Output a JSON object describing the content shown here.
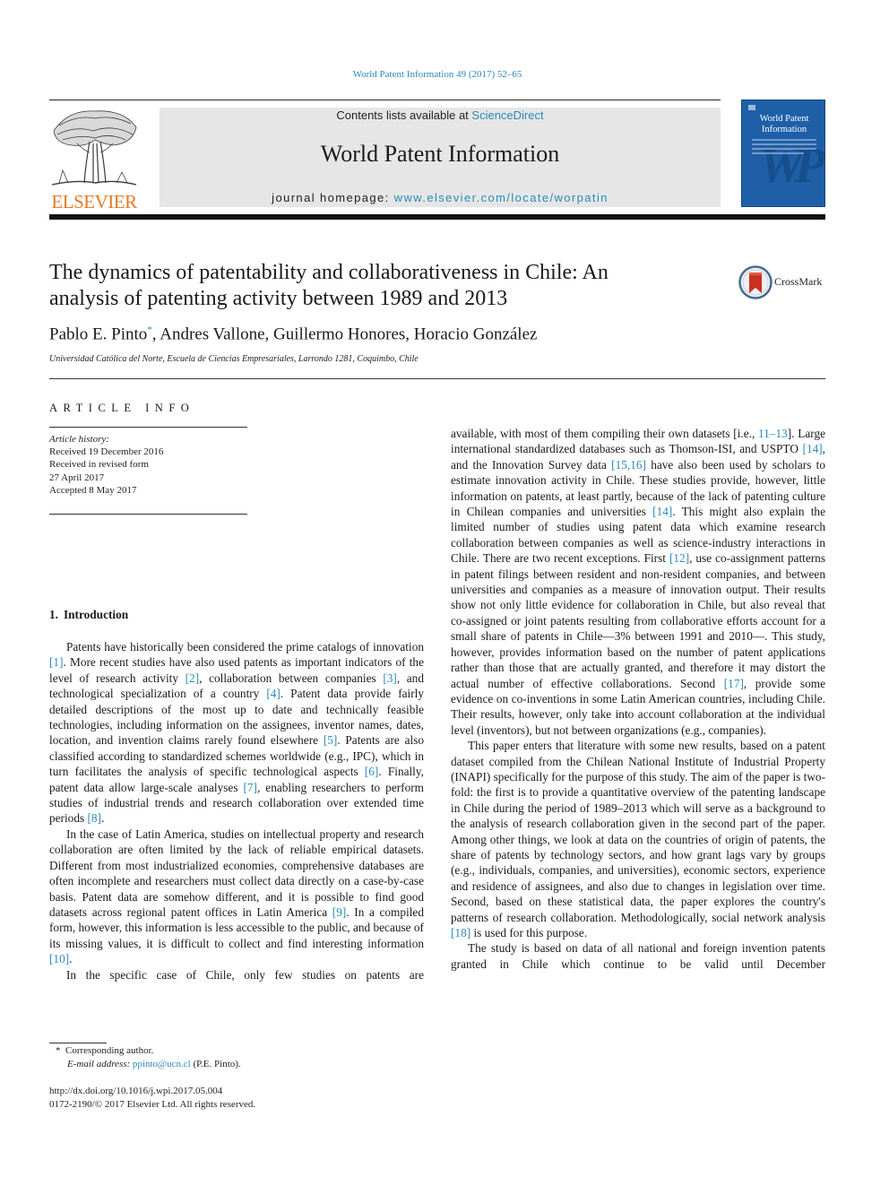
{
  "journal": {
    "citation": "World Patent Information 49 (2017) 52–65",
    "contents_prefix": "Contents lists available at ",
    "contents_link": "ScienceDirect",
    "title": "World Patent Information",
    "homepage_prefix": "journal homepage: ",
    "homepage_link": "www.elsevier.com/locate/worpatin",
    "publisher_logo_text": "ELSEVIER",
    "cover_title": "World Patent Information",
    "cover_monogram": "WP",
    "crossmark_label": "CrossMark",
    "colors": {
      "link": "#2a8ab8",
      "elsevier_orange": "#e87722",
      "cover_blue": "#1e5fa8",
      "banner_gray": "#e6e6e6"
    }
  },
  "article": {
    "title_line1": "The dynamics of patentability and collaborativeness in Chile: An",
    "title_line2": "analysis of patenting activity between 1989 and 2013",
    "authors": [
      {
        "name": "Pablo E. Pinto",
        "mark": "*"
      },
      {
        "name": "Andres Vallone"
      },
      {
        "name": "Guillermo Honores"
      },
      {
        "name": "Horacio González"
      }
    ],
    "affiliation": "Universidad Católica del Norte, Escuela de Ciencias Empresariales, Larrondo 1281, Coquimbo, Chile"
  },
  "article_info": {
    "heading": "ARTICLE INFO",
    "history_label": "Article history:",
    "history": [
      "Received 19 December 2016",
      "Received in revised form",
      "27 April 2017",
      "Accepted 8 May 2017"
    ]
  },
  "section": {
    "number": "1.",
    "title": "Introduction"
  },
  "left_column": {
    "p1": [
      {
        "t": "Patents have historically been considered the prime catalogs of innovation "
      },
      {
        "r": "[1]"
      },
      {
        "t": ". More recent studies have also used patents as important indicators of the level of research activity "
      },
      {
        "r": "[2]"
      },
      {
        "t": ", collaboration between companies "
      },
      {
        "r": "[3]"
      },
      {
        "t": ", and technological specialization of a country "
      },
      {
        "r": "[4]"
      },
      {
        "t": ". Patent data provide fairly detailed descriptions of the most up to date and technically feasible technologies, including information on the assignees, inventor names, dates, location, and invention claims rarely found elsewhere "
      },
      {
        "r": "[5]"
      },
      {
        "t": ". Patents are also classified according to standardized schemes worldwide (e.g., IPC), which in turn facilitates the analysis of specific technological aspects "
      },
      {
        "r": "[6]"
      },
      {
        "t": ". Finally, patent data allow large-scale analyses "
      },
      {
        "r": "[7]"
      },
      {
        "t": ", enabling researchers to perform studies of industrial trends and research collaboration over extended time periods "
      },
      {
        "r": "[8]"
      },
      {
        "t": "."
      }
    ],
    "p2": [
      {
        "t": "In the case of Latin America, studies on intellectual property and research collaboration are often limited by the lack of reliable empirical datasets. Different from most industrialized economies, comprehensive databases are often incomplete and researchers must collect data directly on a case-by-case basis. Patent data are somehow different, and it is possible to find good datasets across regional patent offices in Latin America "
      },
      {
        "r": "[9]"
      },
      {
        "t": ". In a compiled form, however, this information is less accessible to the public, and because of its missing values, it is difficult to collect and find interesting information "
      },
      {
        "r": "[10]"
      },
      {
        "t": "."
      }
    ],
    "p3": [
      {
        "t": "In the specific case of Chile, only few studies on patents are"
      }
    ]
  },
  "right_column": {
    "p1": [
      {
        "t": "available, with most of them compiling their own datasets [i.e., "
      },
      {
        "r": "11–13"
      },
      {
        "t": "]. Large international standardized databases such as Thomson-ISI, and USPTO "
      },
      {
        "r": "[14]"
      },
      {
        "t": ", and the Innovation Survey data "
      },
      {
        "r": "[15,16]"
      },
      {
        "t": " have also been used by scholars to estimate innovation activity in Chile. These studies provide, however, little information on patents, at least partly, because of the lack of patenting culture in Chilean companies and universities "
      },
      {
        "r": "[14]"
      },
      {
        "t": ". This might also explain the limited number of studies using patent data which examine research collaboration between companies as well as science-industry interactions in Chile. There are two recent exceptions. First "
      },
      {
        "r": "[12]"
      },
      {
        "t": ", use co-assignment patterns in patent filings between resident and non-resident companies, and between universities and companies as a measure of innovation output. Their results show not only little evidence for collaboration in Chile, but also reveal that co-assigned or joint patents resulting from collaborative efforts account for a small share of patents in Chile—3% between 1991 and 2010—. This study, however, provides information based on the number of patent applications rather than those that are actually granted, and therefore it may distort the actual number of effective collaborations. Second "
      },
      {
        "r": "[17]"
      },
      {
        "t": ", provide some evidence on co-inventions in some Latin American countries, including Chile. Their results, however, only take into account collaboration at the individual level (inventors), but not between organizations (e.g., companies)."
      }
    ],
    "p2": [
      {
        "t": "This paper enters that literature with some new results, based on a patent dataset compiled from the Chilean National Institute of Industrial Property (INAPI) specifically for the purpose of this study. The aim of the paper is two-fold: the first is to provide a quantitative overview of the patenting landscape in Chile during the period of 1989–2013 which will serve as a background to the analysis of research collaboration given in the second part of the paper. Among other things, we look at data on the countries of origin of patents, the share of patents by technology sectors, and how grant lags vary by groups (e.g., individuals, companies, and universities), economic sectors, experience and residence of assignees, and also due to changes in legislation over time. Second, based on these statistical data, the paper explores the country's patterns of research collaboration. Methodologically, social network analysis "
      },
      {
        "r": "[18]"
      },
      {
        "t": " is used for this purpose."
      }
    ],
    "p3": [
      {
        "t": "The study is based on data of all national and foreign invention patents granted in Chile which continue to be valid until December"
      }
    ]
  },
  "footnotes": {
    "corresponding_mark": "*",
    "corresponding": "Corresponding author.",
    "email_label": "E-mail address:",
    "email": "ppinto@ucn.cl",
    "email_owner": "(P.E. Pinto).",
    "doi": "http://dx.doi.org/10.1016/j.wpi.2017.05.004",
    "copyright": "0172-2190/© 2017 Elsevier Ltd. All rights reserved."
  }
}
